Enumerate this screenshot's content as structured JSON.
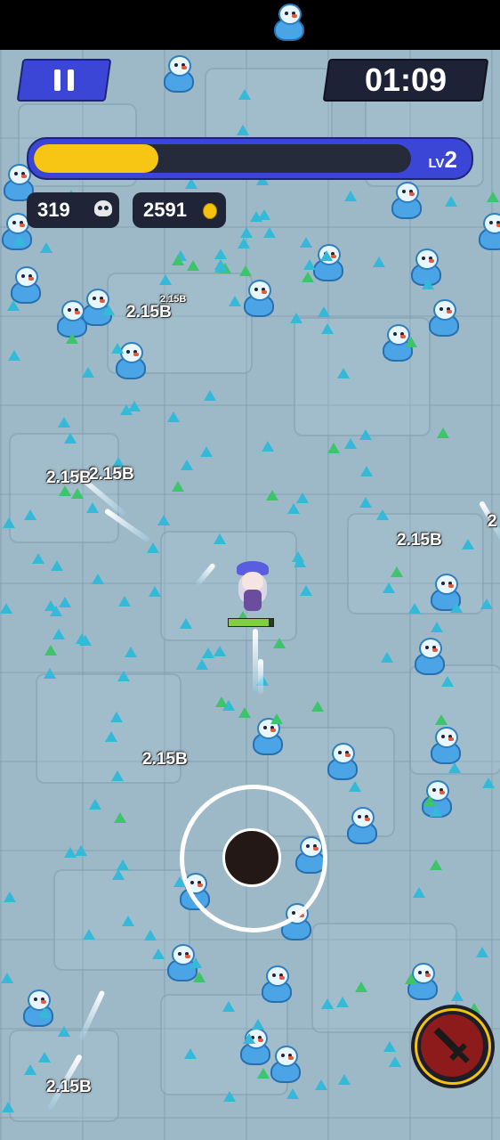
{
  "hud": {
    "pause_icon": "pause-icon",
    "timer": "01:09",
    "xp_progress": 0.33,
    "level_prefix": "LV",
    "level_value": "2",
    "kills": "319",
    "kills_icon": "skull-icon",
    "coins": "2591",
    "coins_icon": "coin-icon"
  },
  "player": {
    "hp_progress": 0.9
  },
  "damage_numbers": [
    {
      "text": "2.15B"
    },
    {
      "text": "2.15B",
      "small": true
    },
    {
      "text": "2.15B"
    },
    {
      "text": "2.15B"
    },
    {
      "text": "2.15B"
    },
    {
      "text": "2.15B"
    },
    {
      "text": "2.15B"
    },
    {
      "text": "2"
    }
  ],
  "skill": {
    "icon": "sword-icon"
  },
  "colors": {
    "accent_blue": "#3b46d6",
    "xp_yellow": "#f7c514",
    "gem_blue": "#35b9d8",
    "gem_green": "#3ec46a"
  }
}
